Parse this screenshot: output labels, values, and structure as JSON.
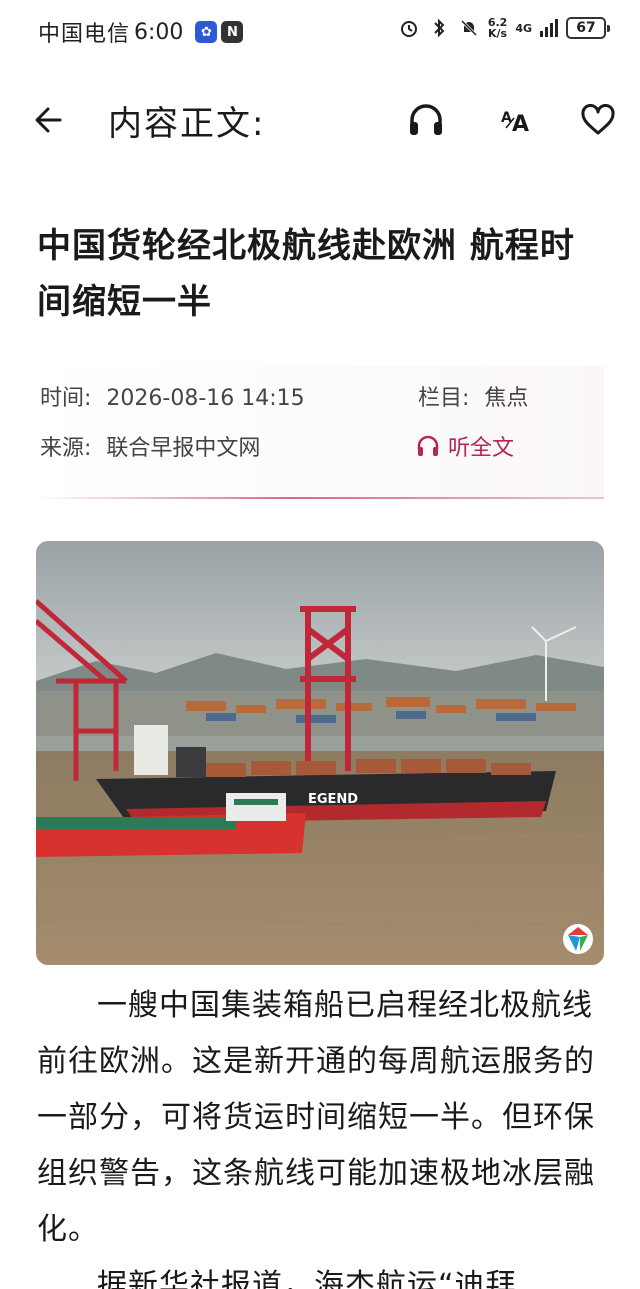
{
  "status_bar": {
    "carrier": "中国电信",
    "time": "6:00",
    "speed_value": "6.2",
    "speed_unit": "K/s",
    "network": "4G",
    "battery": "67"
  },
  "header": {
    "title": "内容正文:",
    "font_button": "A·A"
  },
  "article": {
    "title": "中国货轮经北极航线赴欧洲 航程时间缩短一半",
    "time_label": "时间:",
    "time_value": "2026-08-16 14:15",
    "category_label": "栏目:",
    "category_value": "焦点",
    "source_label": "来源:",
    "source_value": "联合早报中文网",
    "listen_all": "听全文",
    "image_text": "EGEND",
    "paragraphs": [
      "一艘中国集装箱船已启程经北极航线前往欧洲。这是新开通的每周航运服务的一部分，可将货运时间缩短一半。但环保组织警告，这条航线可能加速极地冰层融化。",
      "据新华社报道，海杰航运“迪拜"
    ]
  },
  "colors": {
    "accent": "#b0285a",
    "text": "#1a1a1a"
  }
}
